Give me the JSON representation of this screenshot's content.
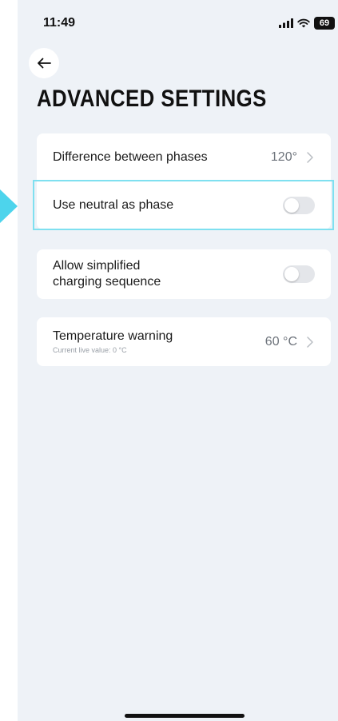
{
  "status_bar": {
    "time": "11:49",
    "battery": "69"
  },
  "header": {
    "back_icon": "arrow-left-icon",
    "title": "ADVANCED SETTINGS"
  },
  "settings": {
    "difference_between_phases": {
      "label": "Difference between phases",
      "value": "120°"
    },
    "use_neutral_as_phase": {
      "label": "Use neutral as phase",
      "enabled": false
    },
    "simplified_charging": {
      "label_line1": "Allow simplified",
      "label_line2": "charging sequence",
      "enabled": false
    },
    "temperature_warning": {
      "label": "Temperature warning",
      "sublabel": "Current live value: 0 °C",
      "value": "60 °C"
    }
  },
  "colors": {
    "background": "#eef2f7",
    "card": "#ffffff",
    "highlight": "#7fe0f0",
    "pointer": "#4dd4ec",
    "toggle_off": "#e4e6ea"
  }
}
